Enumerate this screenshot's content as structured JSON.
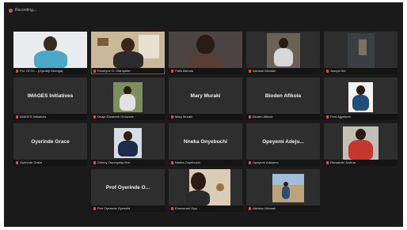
{
  "recording": {
    "label": "Recording..."
  },
  "row1": [
    {
      "name": "Pst. Of Ch... (Oyedeji Gbenga)",
      "active": false
    },
    {
      "name": "Roselyne O. Olampeter",
      "active": true
    },
    {
      "name": "Faith Akinola",
      "active": false
    },
    {
      "name": "Akinkuh Michael",
      "active": false
    },
    {
      "name": "Joseph Ibe",
      "active": false
    }
  ],
  "row2": [
    {
      "name": "IMAGES Initiatives",
      "label": "IMAGES Initiatives"
    },
    {
      "name": "Osaje Elizabeth Omuvwie"
    },
    {
      "name": "Mary Muraki",
      "label": "Mary Muraki"
    },
    {
      "name": "Bioden Afikola",
      "label": "Bioden Afikola"
    },
    {
      "name": "Fred Agyekum"
    }
  ],
  "row3": [
    {
      "name": "Oyerinde Grace",
      "label": "Oyerinde Grace"
    },
    {
      "name": "Chinny Oruonyeka Ifeh"
    },
    {
      "name": "Nneka Onyebuchi",
      "label": "Nneka Onyebuchi"
    },
    {
      "name": "Opeyemi Adejumo",
      "label": "Opeyemi  Adeju..."
    },
    {
      "name": "Oluwatobi Joshua"
    }
  ],
  "row4": [
    {
      "name": "Prof Oyerinde Oyewole",
      "label": "Prof Oyerinde O..."
    },
    {
      "name": "Emmanuel Ogu"
    },
    {
      "name": "Akinkuo Michael"
    }
  ],
  "colors": {
    "active_border": "#c7dd52",
    "muted_mic": "#e04b4b",
    "tile_bg": "#2e2e2e",
    "background": "#1a1a1a"
  }
}
